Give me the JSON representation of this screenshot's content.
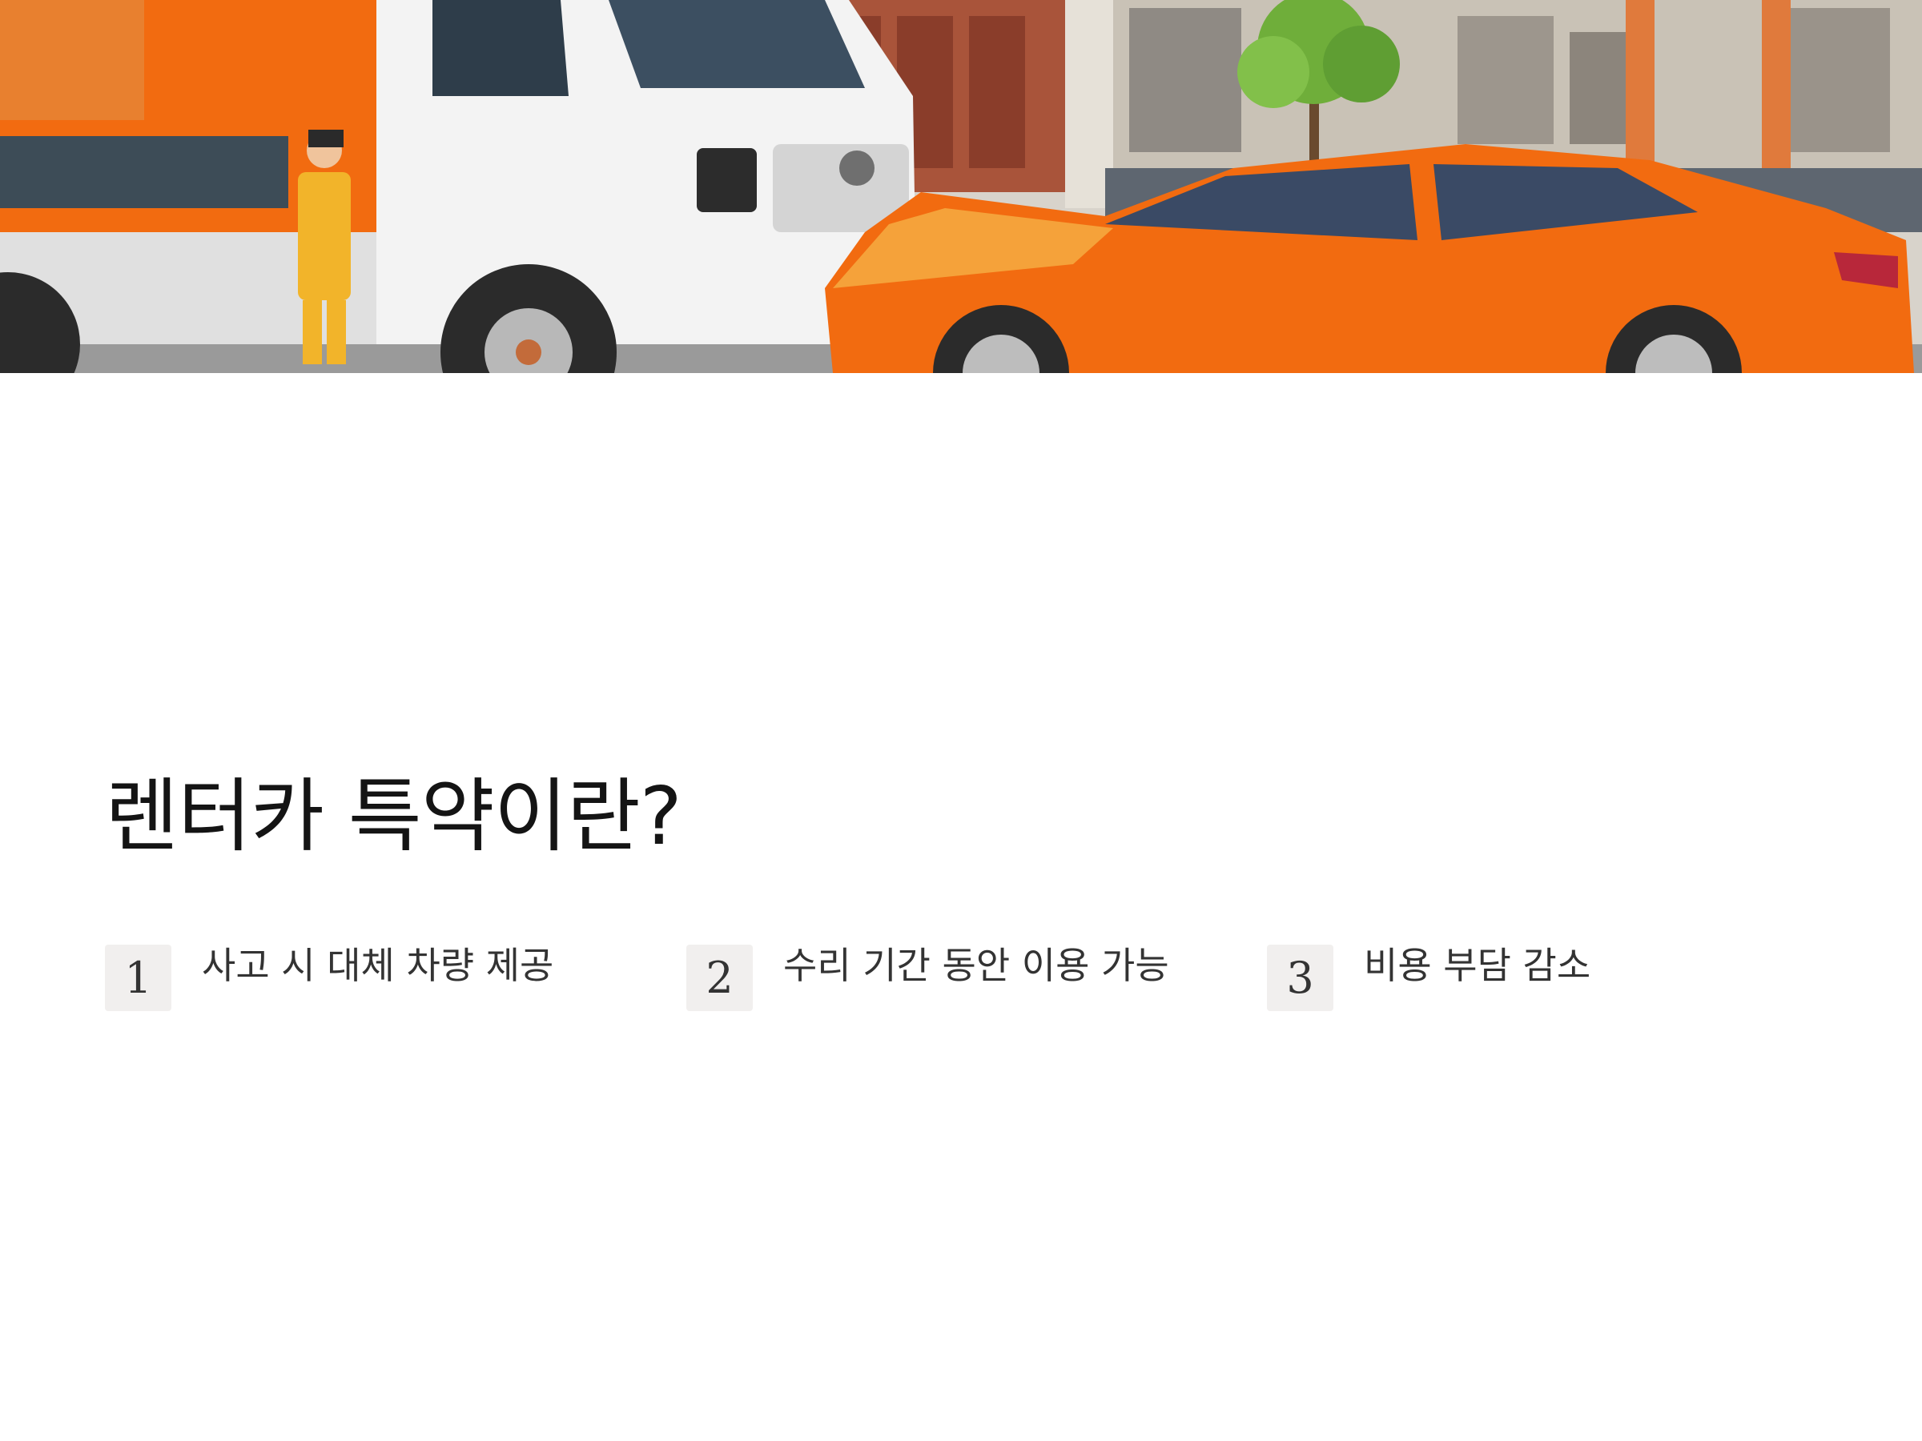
{
  "hero": {
    "image_description_icon": "truck-car-collision-illustration",
    "colors": {
      "orange": "#f26b10",
      "truck_white": "#f2f2f2",
      "building": "#b3553a",
      "sky": "#d9d4cc"
    }
  },
  "title": "렌터카 특약이란?",
  "features": [
    {
      "number": "1",
      "label": "사고 시 대체 차량 제공"
    },
    {
      "number": "2",
      "label": "수리 기간 동안 이용 가능"
    },
    {
      "number": "3",
      "label": "비용 부담 감소"
    }
  ]
}
